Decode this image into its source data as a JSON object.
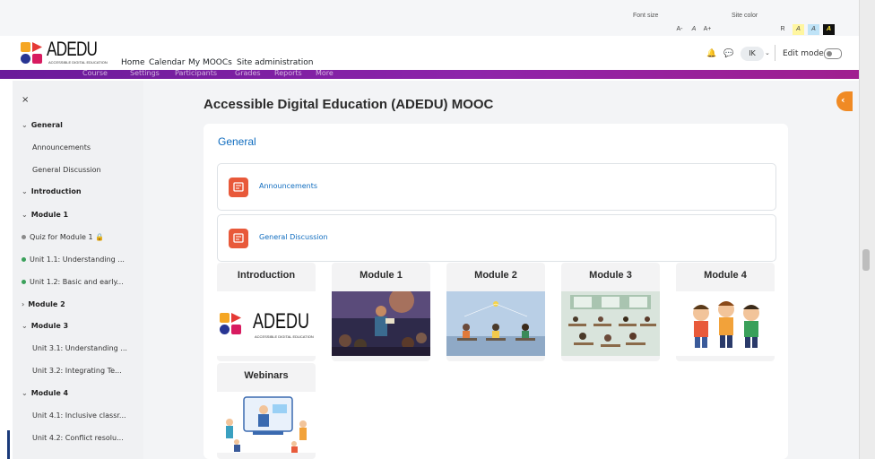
{
  "accessibility": {
    "font_size_label": "Font size",
    "site_color_label": "Site color",
    "font_buttons": [
      "A-",
      "A",
      "A+"
    ],
    "color_buttons": [
      "R",
      "A",
      "A",
      "A"
    ]
  },
  "header": {
    "logo_text": "ADEDU",
    "logo_subtext": "ACCESSIBLE DIGITAL EDUCATION",
    "nav": [
      "Home",
      "Calendar",
      "My MOOCs",
      "Site administration"
    ],
    "secondary_nav": [
      "Course",
      "Settings",
      "Participants",
      "Grades",
      "Reports",
      "More"
    ],
    "user_initials": "IK",
    "edit_mode_label": "Edit mode"
  },
  "drawer": {
    "close_glyph": "×",
    "items": [
      {
        "label": "General",
        "kind": "section"
      },
      {
        "label": "Announcements",
        "kind": "link"
      },
      {
        "label": "General Discussion",
        "kind": "link"
      },
      {
        "label": "Introduction",
        "kind": "section"
      },
      {
        "label": "Module 1",
        "kind": "section"
      },
      {
        "label": "Quiz for Module 1 🔒",
        "kind": "grey"
      },
      {
        "label": "Unit 1.1: Understanding ...",
        "kind": "green"
      },
      {
        "label": "Unit 1.2: Basic and early...",
        "kind": "green"
      },
      {
        "label": "Module 2",
        "kind": "collapsed"
      },
      {
        "label": "Module 3",
        "kind": "section"
      },
      {
        "label": "Unit 3.1: Understanding ...",
        "kind": "link"
      },
      {
        "label": "Unit 3.2: Integrating Te...",
        "kind": "link"
      },
      {
        "label": "Module 4",
        "kind": "section"
      },
      {
        "label": "Unit 4.1: Inclusive classr...",
        "kind": "link"
      },
      {
        "label": "Unit 4.2: Conflict resolu...",
        "kind": "link"
      }
    ]
  },
  "main": {
    "course_title": "Accessible Digital Education (ADEDU) MOOC",
    "section_title": "General",
    "activities": [
      "Announcements",
      "General Discussion"
    ],
    "tiles": [
      "Introduction",
      "Module 1",
      "Module 2",
      "Module 3",
      "Module 4",
      "Webinars"
    ]
  },
  "colors": {
    "accent": "#0f6cbf",
    "header_bar": "#8e24aa",
    "activity_icon": "#e8593a",
    "collapse_button": "#f08a24"
  }
}
